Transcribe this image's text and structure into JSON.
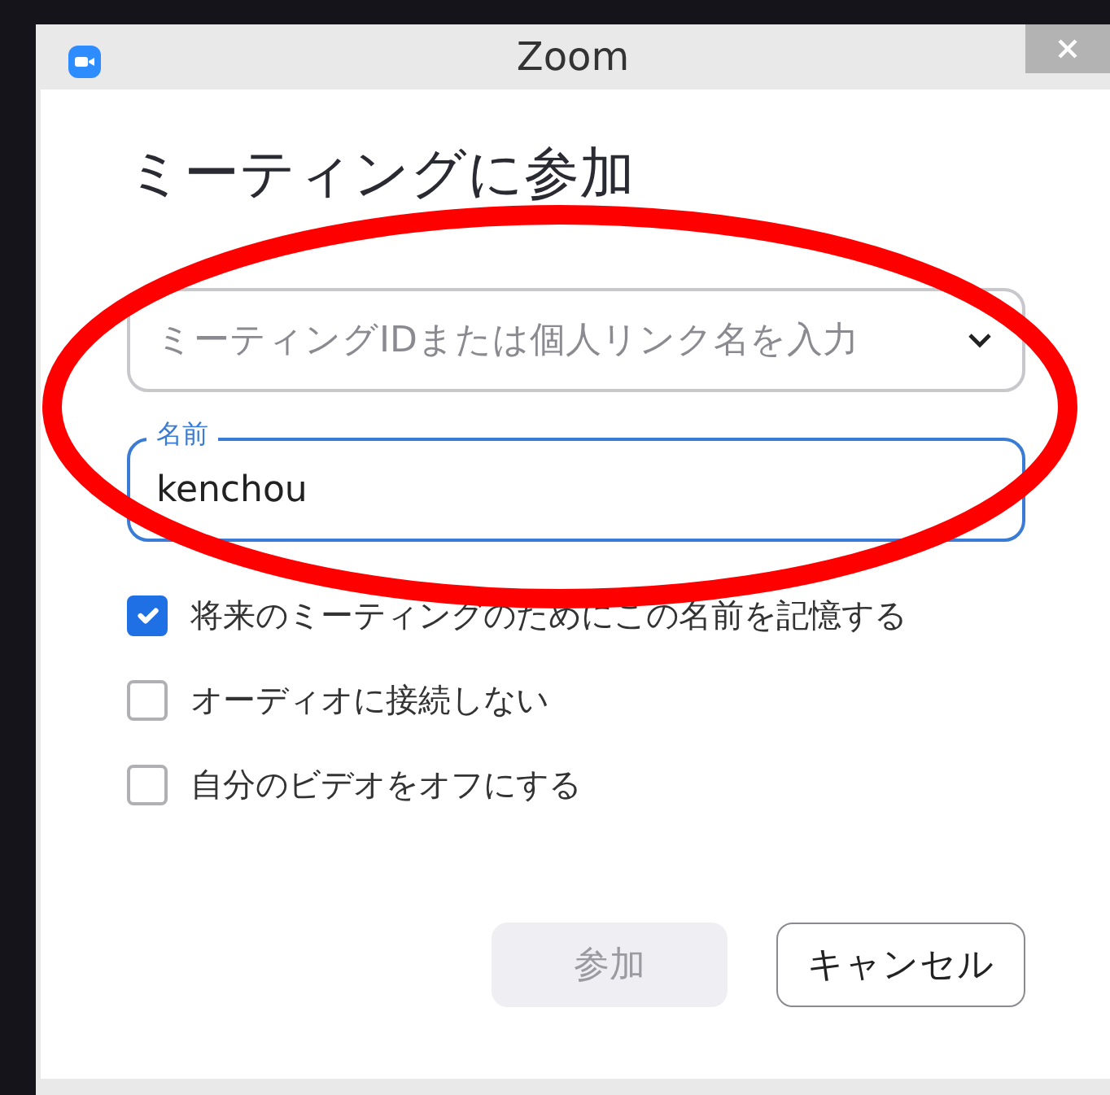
{
  "window": {
    "title": "Zoom"
  },
  "heading": "ミーティングに参加",
  "meeting_field": {
    "placeholder": "ミーティングIDまたは個人リンク名を入力"
  },
  "name_field": {
    "label": "名前",
    "value": "kenchou",
    "focused": true
  },
  "options": [
    {
      "label": "将来のミーティングのためにこの名前を記憶する",
      "checked": true
    },
    {
      "label": "オーディオに接続しない",
      "checked": false
    },
    {
      "label": "自分のビデオをオフにする",
      "checked": false
    }
  ],
  "buttons": [
    {
      "label": "参加",
      "kind": "primary",
      "disabled": true
    },
    {
      "label": "キャンセル",
      "kind": "secondary",
      "disabled": false
    }
  ]
}
